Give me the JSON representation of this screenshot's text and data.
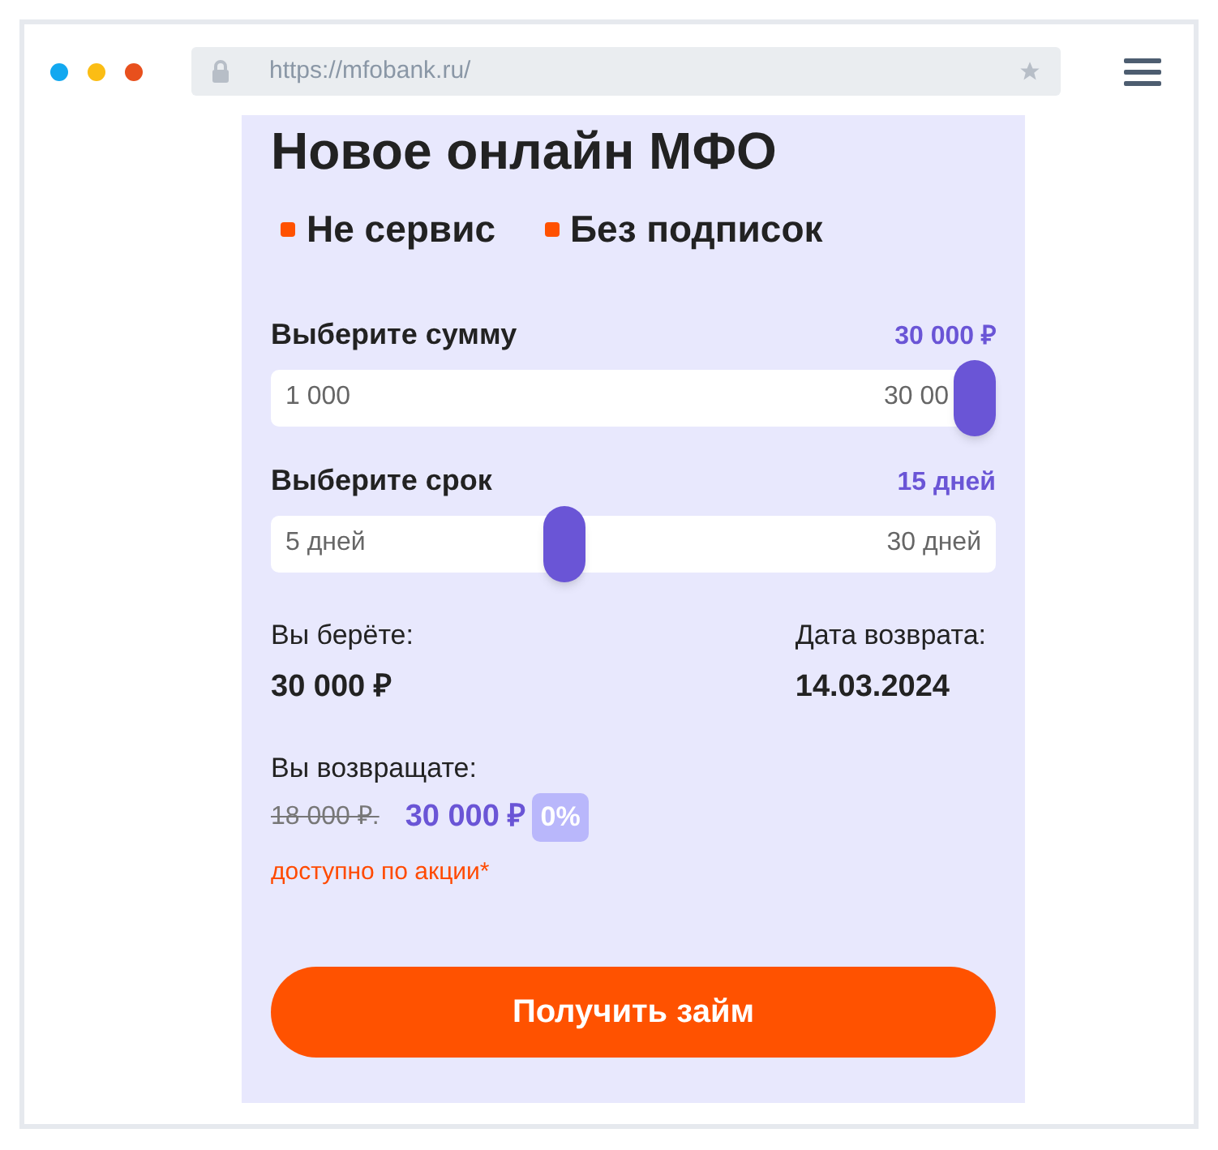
{
  "browser": {
    "url": "https://mfobank.ru/"
  },
  "heading": "Новое онлайн МФО",
  "features": [
    "Не сервис",
    "Без подписок"
  ],
  "sliders": [
    {
      "label": "Выберите сумму",
      "value": "30 000 ₽",
      "min": "1 000",
      "max": "30 00",
      "level": 1
    },
    {
      "label": "Выберите срок",
      "value": "15 дней",
      "min": "5 дней",
      "max": "30 дней",
      "level": 0.4
    }
  ],
  "summary": {
    "take_label": "Вы берёте:",
    "take_value": "30 000 ₽",
    "date_label": "Дата возврата:",
    "date_value": "14.03.2024"
  },
  "return": {
    "label": "Вы возвращате:",
    "old_price": "18 000 ₽.",
    "new_price": "30 000 ₽",
    "rate": "0%",
    "promo": "доступно по акции*"
  },
  "cta": "Получить займ"
}
